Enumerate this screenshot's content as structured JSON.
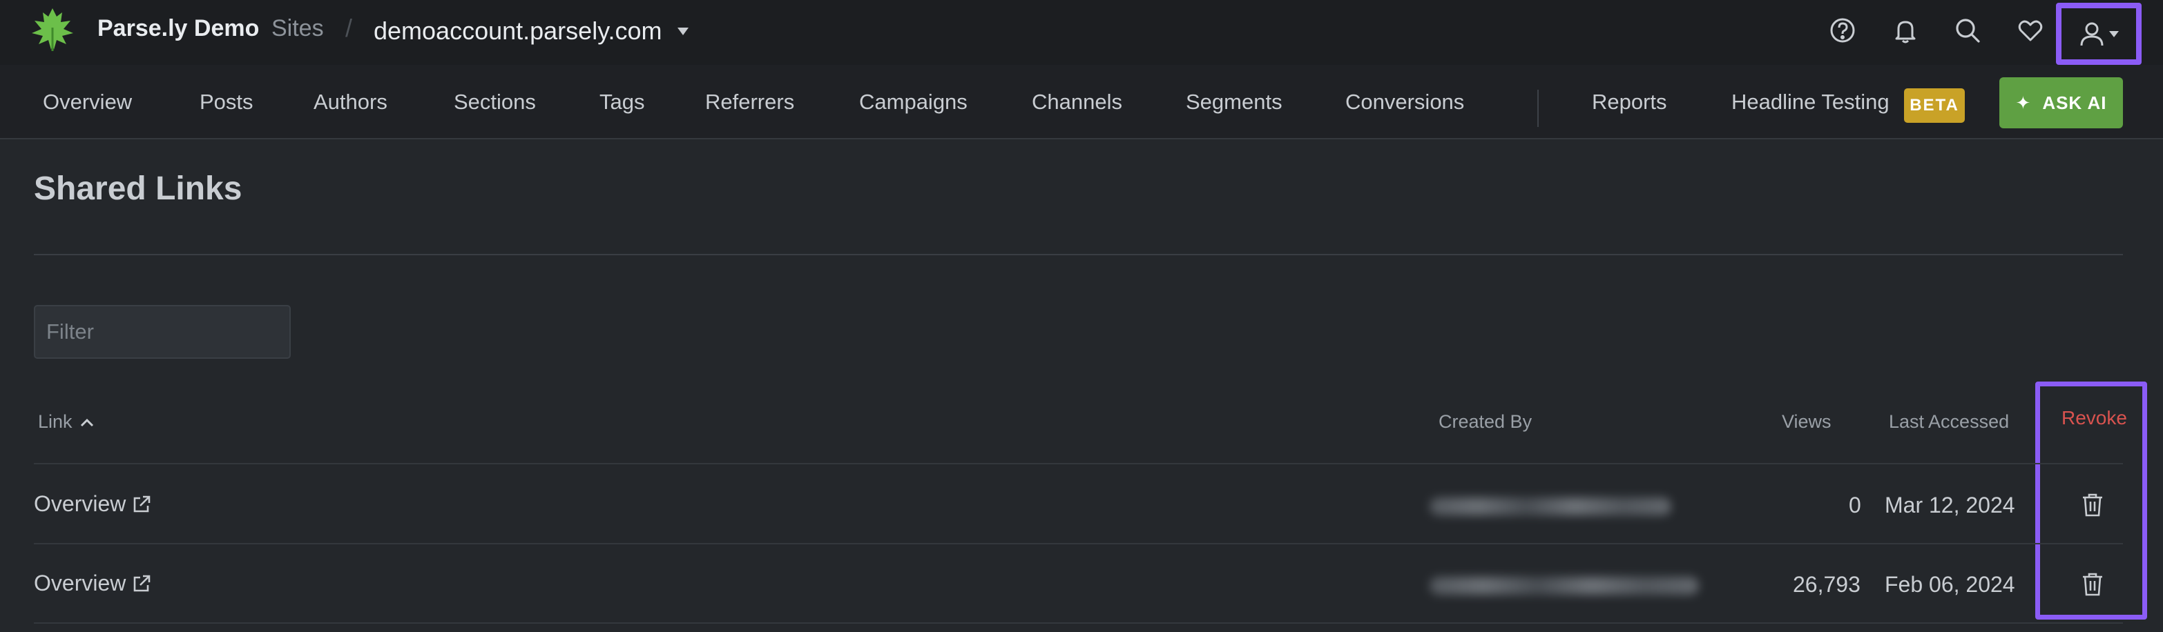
{
  "header": {
    "brand": "Parse.ly Demo",
    "sites_label": "Sites",
    "separator": "/",
    "site_name": "demoaccount.parsely.com",
    "icons": [
      "help-icon",
      "bell-icon",
      "search-icon",
      "heart-icon",
      "user-icon"
    ]
  },
  "nav": {
    "items": [
      "Overview",
      "Posts",
      "Authors",
      "Sections",
      "Tags",
      "Referrers",
      "Campaigns",
      "Channels",
      "Segments",
      "Conversions"
    ],
    "secondary": [
      "Reports",
      "Headline Testing"
    ],
    "beta": "BETA",
    "ask_ai": "ASK AI"
  },
  "page": {
    "title": "Shared Links",
    "filter_placeholder": "Filter"
  },
  "table": {
    "headers": {
      "link": "Link",
      "created_by": "Created By",
      "views": "Views",
      "last_accessed": "Last Accessed",
      "revoke": "Revoke"
    },
    "rows": [
      {
        "link": "Overview",
        "views": "0",
        "last_accessed": "Mar 12, 2024"
      },
      {
        "link": "Overview",
        "views": "26,793",
        "last_accessed": "Feb 06, 2024"
      }
    ]
  },
  "colors": {
    "accent": "#8b5cf6",
    "ask_ai": "#5fa043",
    "beta": "#c9a227",
    "revoke": "#d9534f"
  }
}
